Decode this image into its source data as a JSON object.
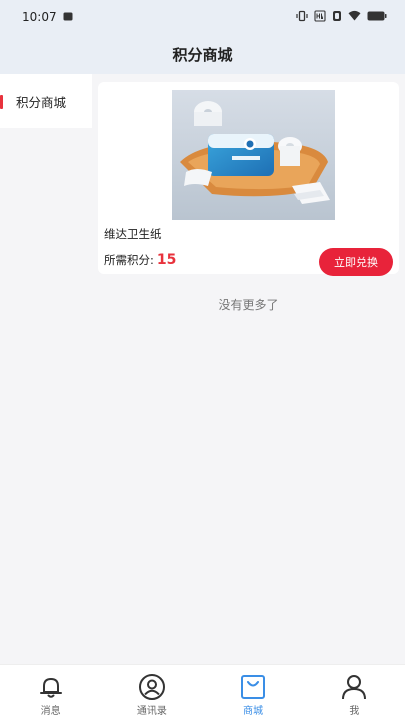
{
  "status_bar": {
    "time": "10:07"
  },
  "header": {
    "title": "积分商城"
  },
  "sidebar": {
    "items": [
      {
        "label": "积分商城",
        "active": true
      }
    ]
  },
  "products": [
    {
      "name": "维达卫生纸",
      "points_label": "所需积分:",
      "points_value": "15",
      "button_label": "立即兑换"
    }
  ],
  "list_end_text": "没有更多了",
  "tabbar": {
    "tabs": [
      {
        "label": "消息",
        "icon": "bell-icon",
        "active": false
      },
      {
        "label": "通讯录",
        "icon": "contact-icon",
        "active": false
      },
      {
        "label": "商城",
        "icon": "shopping-bag-icon",
        "active": true
      },
      {
        "label": "我",
        "icon": "person-icon",
        "active": false
      }
    ]
  },
  "colors": {
    "accent_red": "#e8233a",
    "active_tab": "#3a8ee6",
    "header_bg": "#e9eef5"
  }
}
